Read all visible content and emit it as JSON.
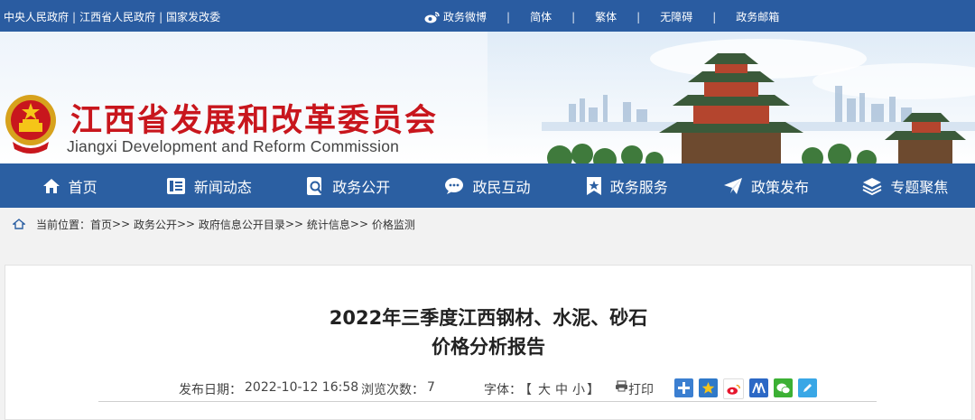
{
  "topbar": {
    "links": [
      "中央人民政府",
      "江西省人民政府",
      "国家发改委"
    ],
    "separator": "|",
    "weibo_label": "政务微博",
    "simplified": "简体",
    "traditional": "繁体",
    "accessible": "无障碍",
    "mailbox": "政务邮箱",
    "bar": "|"
  },
  "header": {
    "title": "江西省发展和改革委员会",
    "subtitle": "Jiangxi Development and Reform Commission"
  },
  "nav": {
    "items": [
      {
        "label": "首页",
        "icon": "home-icon"
      },
      {
        "label": "新闻动态",
        "icon": "news-icon"
      },
      {
        "label": "政务公开",
        "icon": "search-doc-icon"
      },
      {
        "label": "政民互动",
        "icon": "chat-icon"
      },
      {
        "label": "政务服务",
        "icon": "star-bookmark-icon"
      },
      {
        "label": "政策发布",
        "icon": "paper-plane-icon"
      },
      {
        "label": "专题聚焦",
        "icon": "layers-icon"
      }
    ]
  },
  "breadcrumb": {
    "prefix": "当前位置：",
    "items": [
      "首页",
      "政务公开",
      "政府信息公开目录",
      "统计信息",
      "价格监测"
    ],
    "sep": ">>"
  },
  "article": {
    "title_line1": "2022年三季度江西钢材、水泥、砂石",
    "title_line2": "价格分析报告",
    "date_label": "发布日期：",
    "date_value": "2022-10-12 16:58",
    "views_label": "浏览次数：",
    "views_value": "7",
    "font_label": "字体：",
    "font_open": "【",
    "font_large": "大",
    "font_medium": "中",
    "font_small": "小",
    "font_close": "】",
    "print_label": "打印"
  },
  "colors": {
    "brand_blue": "#2b5fa2",
    "title_red": "#c8161d"
  }
}
